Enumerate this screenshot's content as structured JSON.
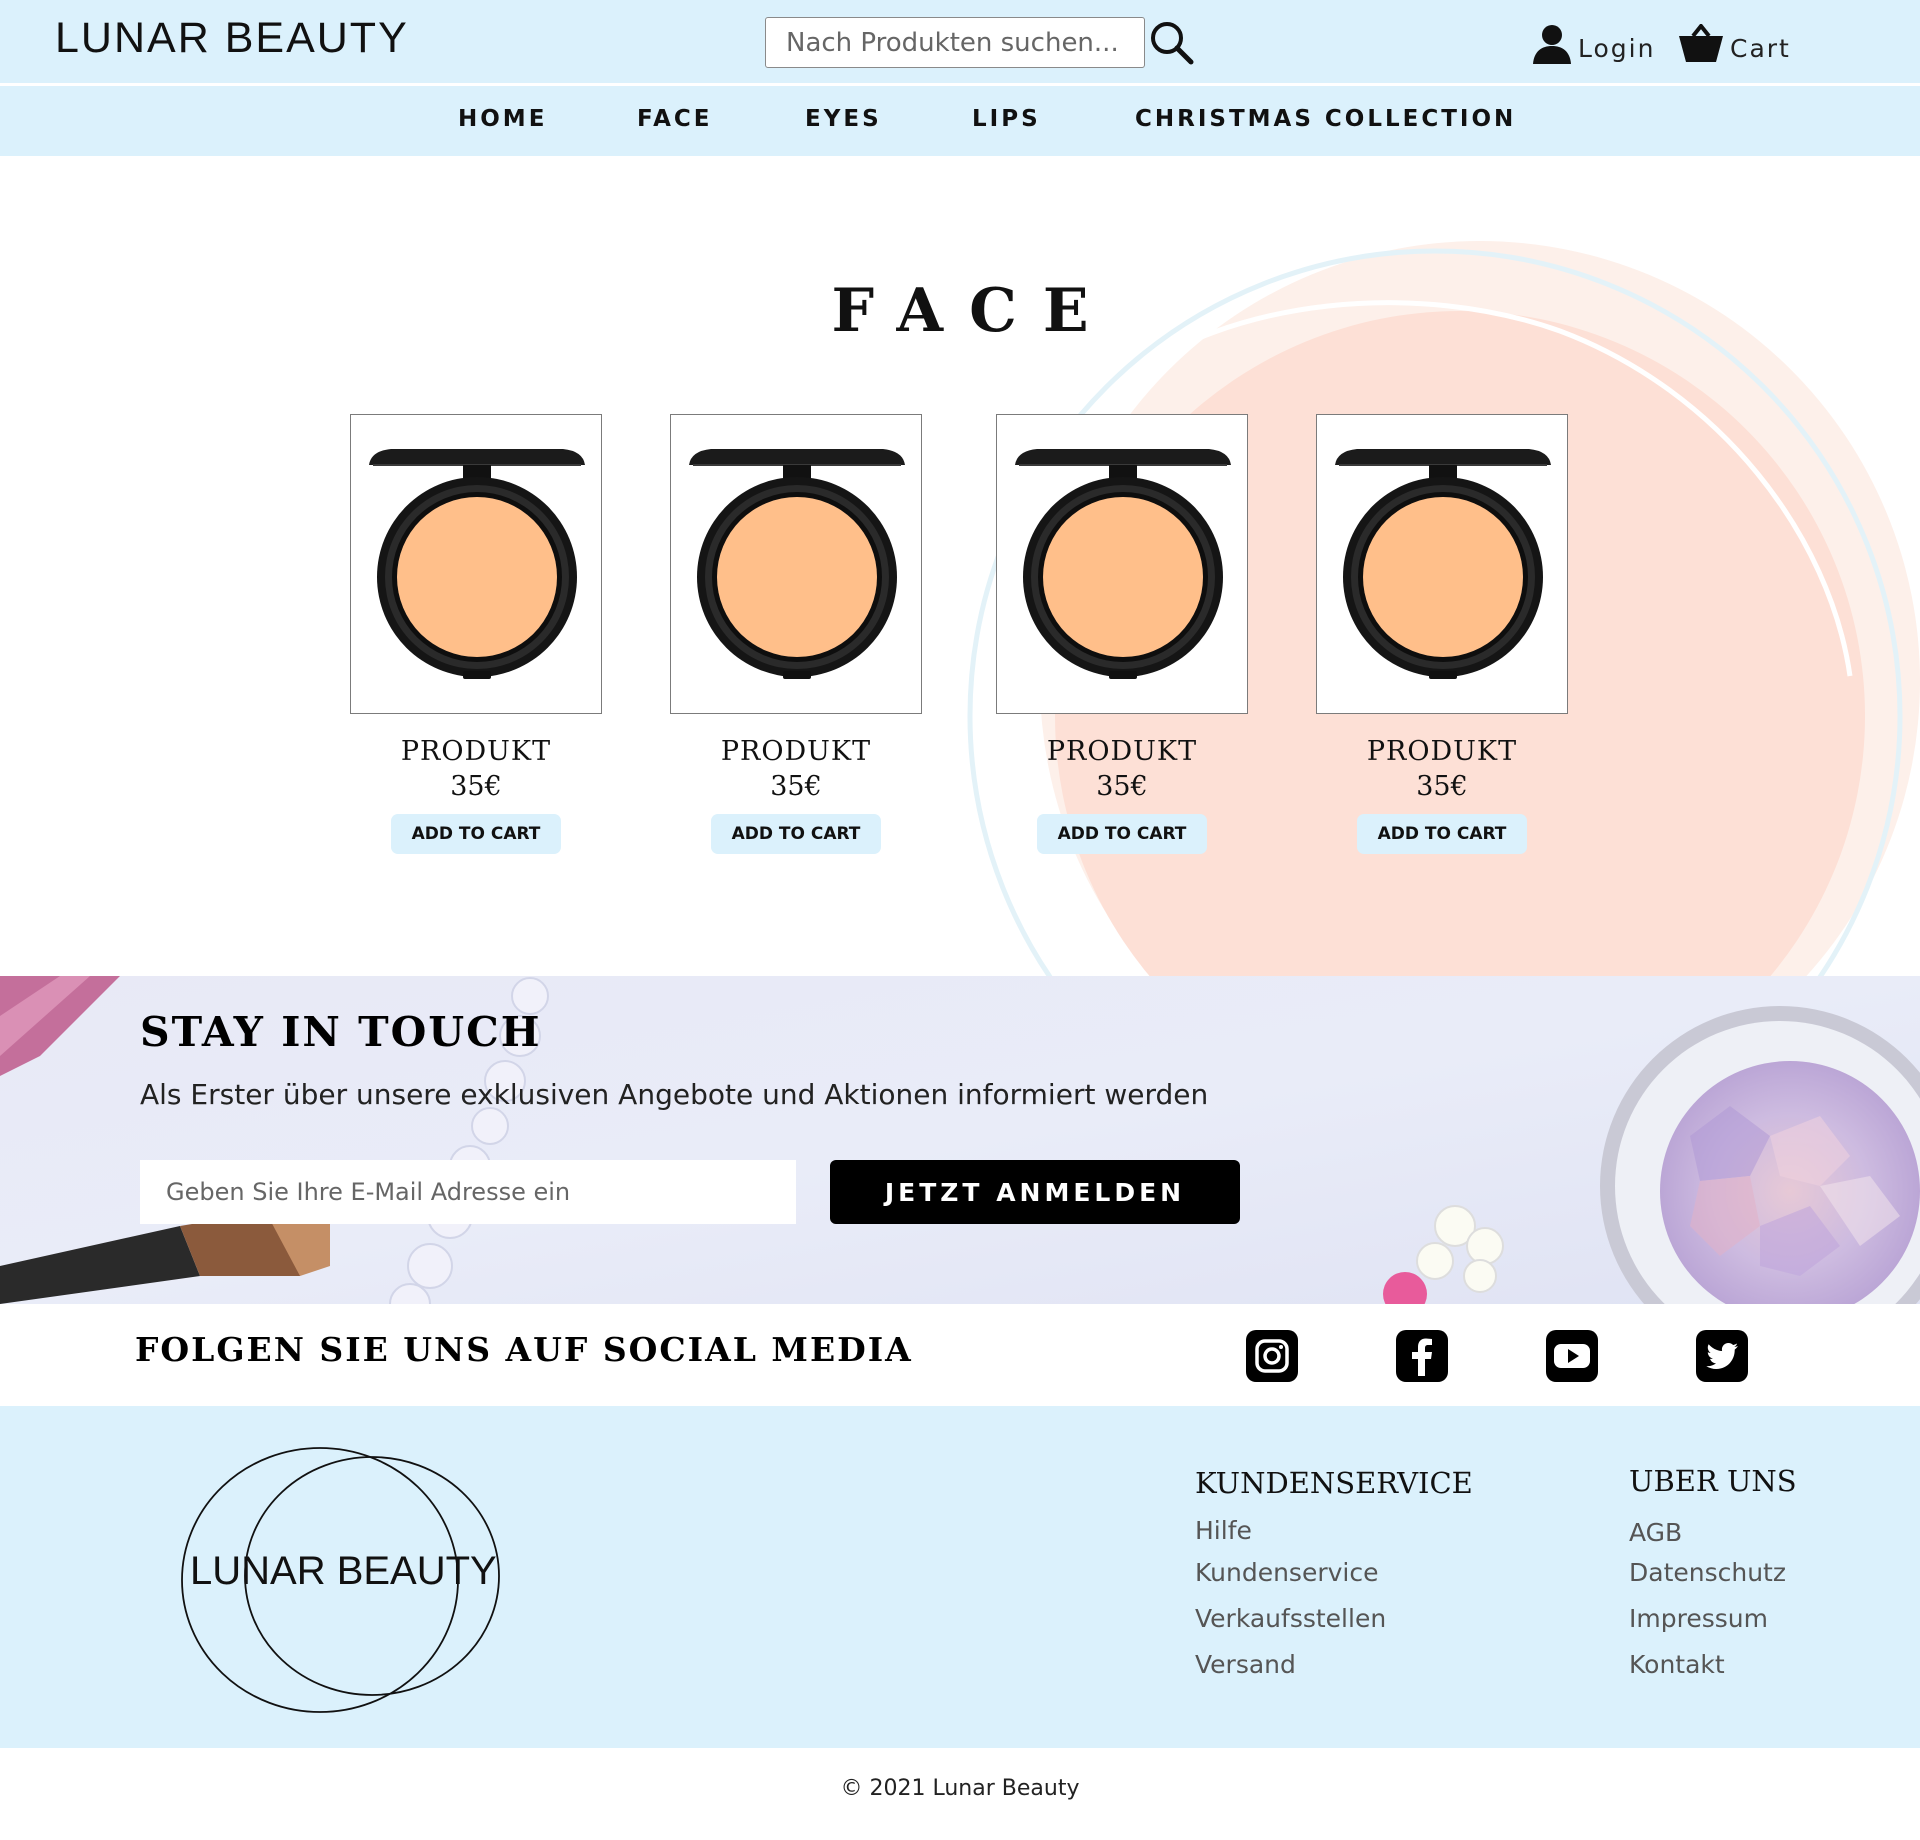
{
  "header": {
    "logo": "LUNAR BEAUTY",
    "search_placeholder": "Nach Produkten suchen...",
    "login_label": "Login",
    "cart_label": "Cart"
  },
  "nav": {
    "items": [
      {
        "label": "HOME"
      },
      {
        "label": "FACE"
      },
      {
        "label": "EYES"
      },
      {
        "label": "LIPS"
      },
      {
        "label": "CHRISTMAS COLLECTION"
      }
    ]
  },
  "section": {
    "title": "FACE"
  },
  "products": [
    {
      "name": "PRODUKT",
      "price": "35€",
      "button": "ADD TO CART"
    },
    {
      "name": "PRODUKT",
      "price": "35€",
      "button": "ADD TO CART"
    },
    {
      "name": "PRODUKT",
      "price": "35€",
      "button": "ADD TO CART"
    },
    {
      "name": "PRODUKT",
      "price": "35€",
      "button": "ADD TO CART"
    }
  ],
  "newsletter": {
    "title": "STAY IN TOUCH",
    "text": "Als Erster über unsere exklusiven Angebote und Aktionen informiert werden",
    "email_placeholder": "Geben Sie Ihre E-Mail Adresse ein",
    "button": "JETZT ANMELDEN"
  },
  "social": {
    "title": "FOLGEN SIE UNS AUF SOCIAL MEDIA",
    "icons": [
      "instagram-icon",
      "facebook-icon",
      "youtube-icon",
      "twitter-icon"
    ]
  },
  "footer": {
    "logo": "LUNAR BEAUTY",
    "columns": [
      {
        "title": "KUNDENSERVICE",
        "links": [
          "Hilfe",
          "Kundenservice",
          "Verkaufsstellen",
          "Versand"
        ]
      },
      {
        "title": "UBER UNS",
        "links": [
          "AGB",
          "Datenschutz",
          "Impressum",
          "Kontakt"
        ]
      }
    ],
    "copyright": "© 2021 Lunar Beauty"
  },
  "colors": {
    "header_bg": "#dbf1fc",
    "deco_peach": "#fde3da",
    "button_dark": "#000000",
    "footer_bg": "#dbf1fc"
  }
}
